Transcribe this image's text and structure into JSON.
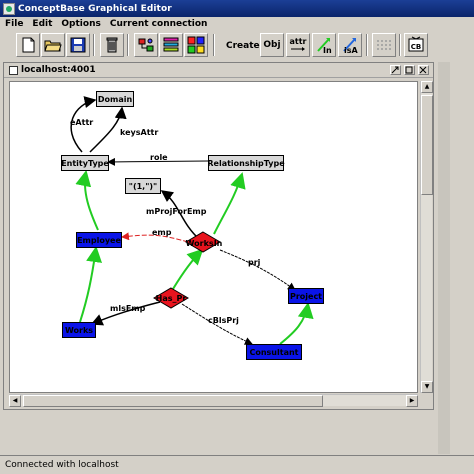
{
  "window": {
    "title": "ConceptBase Graphical Editor"
  },
  "menu": {
    "items": [
      "File",
      "Edit",
      "Options",
      "Current connection"
    ]
  },
  "toolbar": {
    "create_label": "Create",
    "obj_label": "Obj",
    "attr_label": "attr",
    "in_label": "In",
    "isa_label": "isA",
    "cb_label": "CB"
  },
  "frame": {
    "title": "localhost:4001"
  },
  "graph": {
    "nodes": {
      "domain": "Domain",
      "entity_type": "EntityType",
      "relationship_type": "RelationshipType",
      "tuple": "\"(1,\")\"",
      "works_in": "WorksIn",
      "employee": "Employee",
      "has_pr": "Has_Pr",
      "project": "Project",
      "works": "Works",
      "consultant": "Consultant"
    },
    "edges": {
      "eattr": "eAttr",
      "keyattr": "keysAttr",
      "role": "role",
      "mprojfor": "mProjForEmp",
      "emp": "emp",
      "prj": "prj",
      "mlsemp": "mlsEmp",
      "cblspri": "cBlsPrj"
    }
  },
  "colors": {
    "entity_node": "#d8d8d8",
    "instance_node": "#0a14e8",
    "relationship_node": "#e8141e",
    "in_link": "#22cc22",
    "emp_link": "#dd2222"
  },
  "status": {
    "text": "Connected with localhost"
  }
}
